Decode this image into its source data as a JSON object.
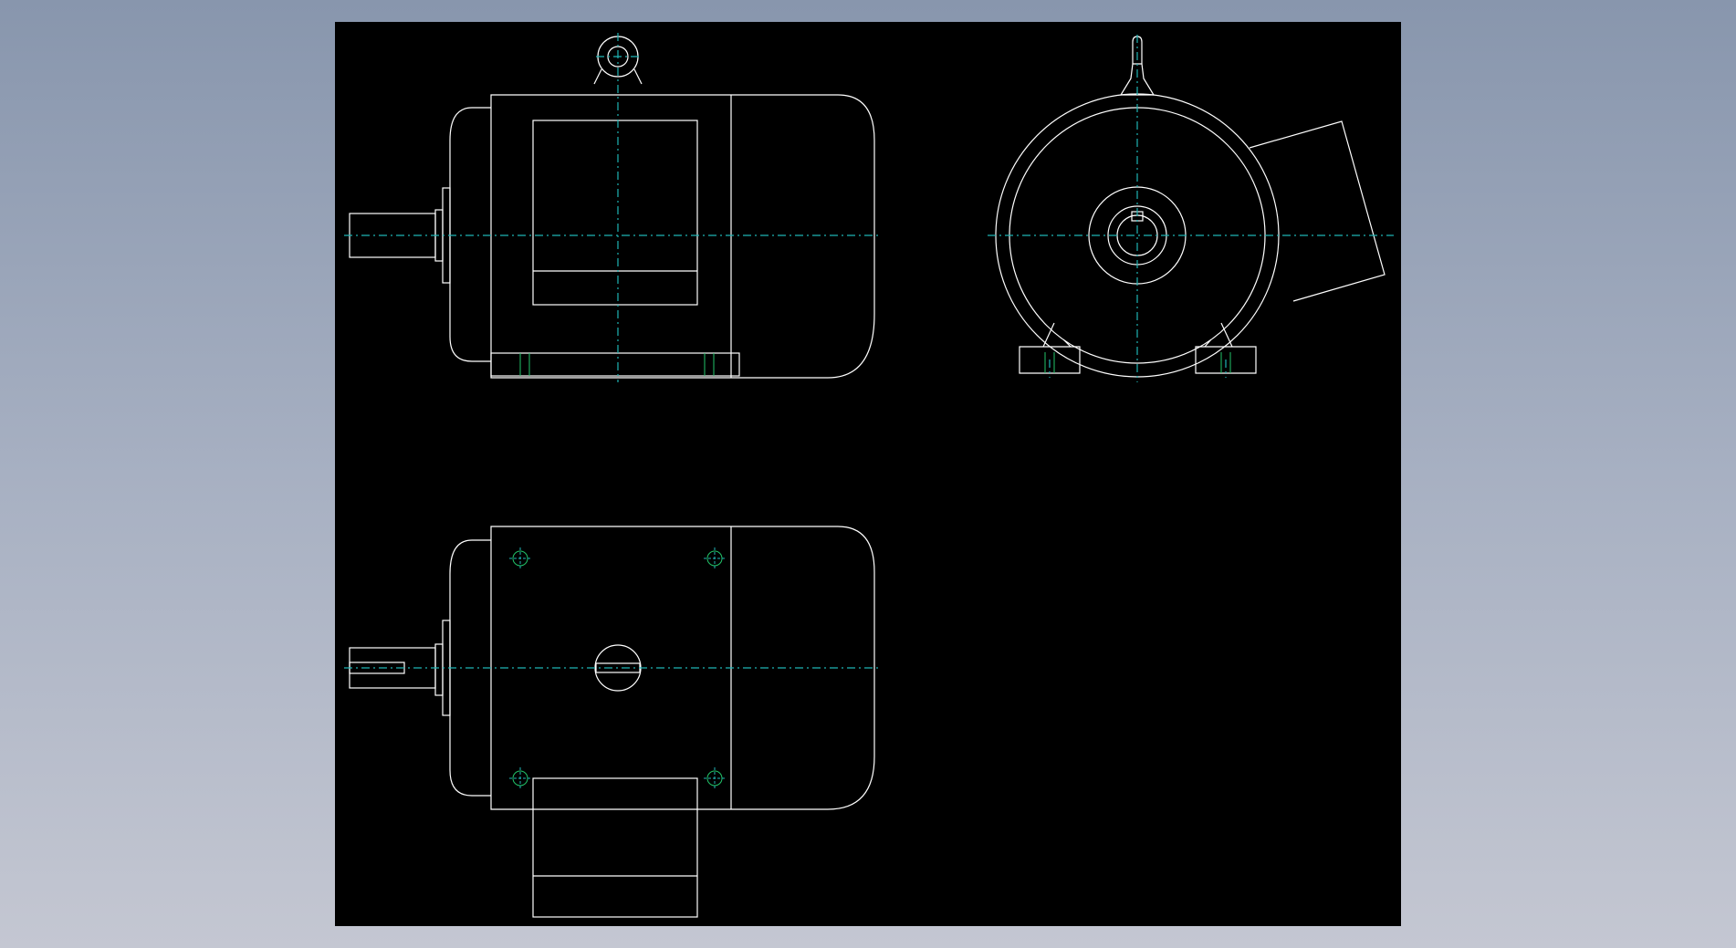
{
  "viewport": {
    "background_gradient": [
      "#8896ad",
      "#c4c7d2"
    ],
    "sheet_color": "#000000"
  },
  "colors": {
    "outline": "#ffffff",
    "centerline": "#1fb5b5",
    "hole_marker": "#22c56a"
  },
  "views": [
    {
      "name": "front-view"
    },
    {
      "name": "end-view"
    },
    {
      "name": "top-view"
    }
  ]
}
